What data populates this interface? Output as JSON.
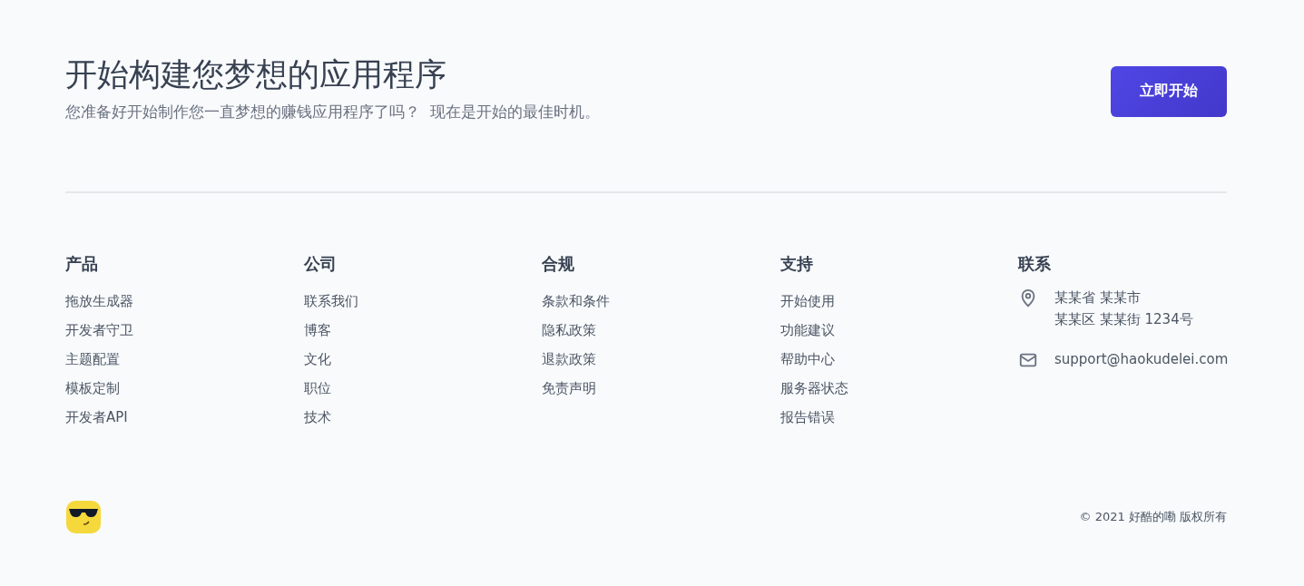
{
  "cta": {
    "title": "开始构建您梦想的应用程序",
    "subtitle": "您准备好开始制作您一直梦想的赚钱应用程序了吗？  现在是开始的最佳时机。",
    "button": "立即开始"
  },
  "columns": [
    {
      "heading": "产品",
      "links": [
        "拖放生成器",
        "开发者守卫",
        "主题配置",
        "模板定制",
        "开发者API"
      ]
    },
    {
      "heading": "公司",
      "links": [
        "联系我们",
        "博客",
        "文化",
        "职位",
        "技术"
      ]
    },
    {
      "heading": "合规",
      "links": [
        "条款和条件",
        "隐私政策",
        "退款政策",
        "免责声明"
      ]
    },
    {
      "heading": "支持",
      "links": [
        "开始使用",
        "功能建议",
        "帮助中心",
        "服务器状态",
        "报告错误"
      ]
    }
  ],
  "contact": {
    "heading": "联系",
    "items": [
      {
        "kind": "address",
        "lines": [
          "某某省 某某市",
          "某某区 某某街 1234号"
        ]
      },
      {
        "kind": "email",
        "lines": [
          "support@haokudelei.com"
        ]
      }
    ]
  },
  "copyright": "© 2021 好酷的嘞 版权所有"
}
